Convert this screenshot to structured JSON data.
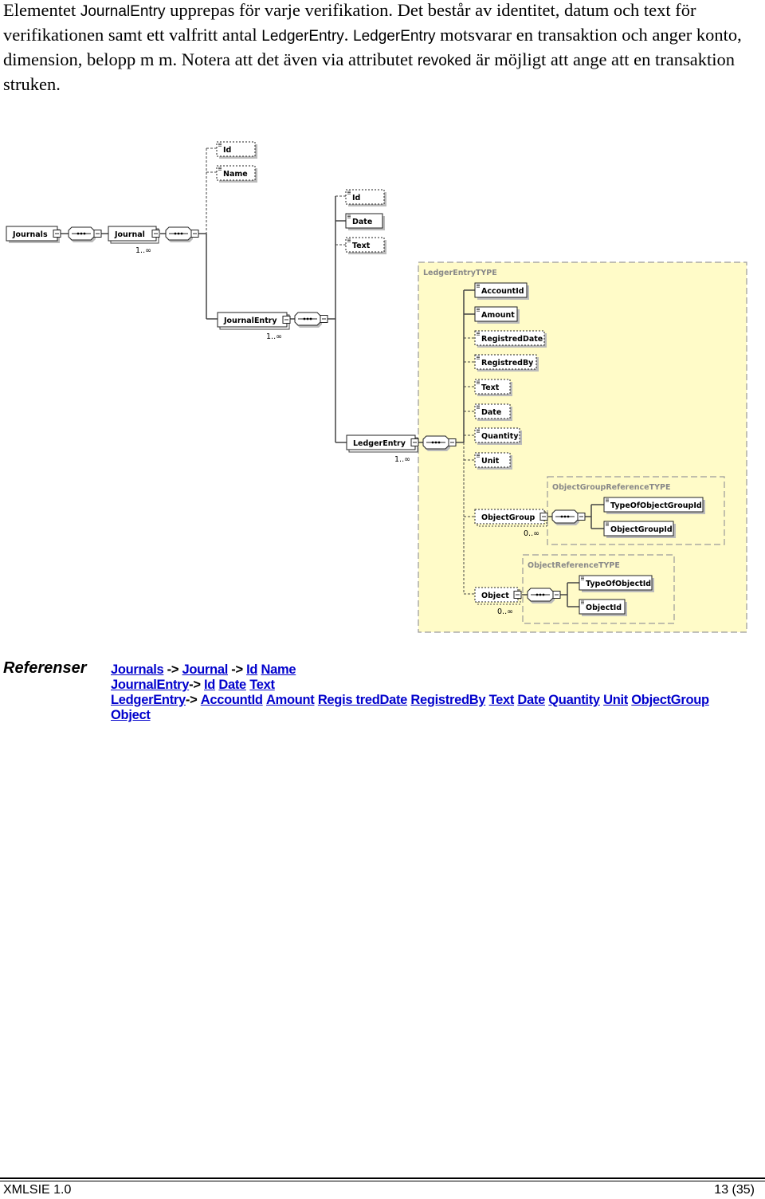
{
  "intro": {
    "p1": "Elementet ",
    "c1": "JournalEntry",
    "p2": " upprepas för varje verifikation. Det består av identitet, datum och text för verifikationen samt ett valfritt antal ",
    "c2": "LedgerEntry",
    "p3": ". ",
    "c3": "LedgerEntry",
    "p4": " motsvarar en transaktion och anger konto, dimension, belopp m m. Notera att det även via attributet ",
    "c4": "revoked",
    "p5": " är möjligt att ange att en transaktion struken."
  },
  "diagram": {
    "elements": {
      "journals": "Journals",
      "journal": "Journal",
      "journal_id": "Id",
      "journal_name": "Name",
      "journal_entry": "JournalEntry",
      "je_id": "Id",
      "je_date": "Date",
      "je_text": "Text",
      "ledger_entry": "LedgerEntry",
      "account_id": "AccountId",
      "amount": "Amount",
      "registred_date": "RegistredDate",
      "registred_by": "RegistredBy",
      "le_text": "Text",
      "le_date": "Date",
      "quantity": "Quantity",
      "unit": "Unit",
      "object_group": "ObjectGroup",
      "type_of_object_group_id": "TypeOfObjectGroupId",
      "object_group_id": "ObjectGroupId",
      "object": "Object",
      "type_of_object_id": "TypeOfObjectId",
      "object_id": "ObjectId"
    },
    "types": {
      "ledger_entry_type": "LedgerEntryTYPE",
      "object_group_reference_type": "ObjectGroupReferenceTYPE",
      "object_reference_type": "ObjectReferenceTYPE"
    },
    "cardinality": {
      "one_many": "1..∞",
      "zero_many": "0..∞"
    },
    "colors": {
      "type_background": "#fffbc8",
      "type_border": "#9a9a9a"
    }
  },
  "references": {
    "title": "Referenser",
    "arrow": "->",
    "line1": [
      "Journals",
      "Journal",
      "Id",
      "Name"
    ],
    "line2": [
      "JournalEntry",
      "Id",
      "Date",
      "Text"
    ],
    "line3": [
      "LedgerEntry",
      "AccountId",
      "Amount",
      "Regis tredDate",
      "RegistredBy",
      "Text",
      "Date",
      "Quantity",
      "Unit",
      "ObjectGroup",
      "Object"
    ],
    "link_color": "#0000cc"
  },
  "footer": {
    "left": "XMLSIE 1.0",
    "right": "13 (35)"
  }
}
